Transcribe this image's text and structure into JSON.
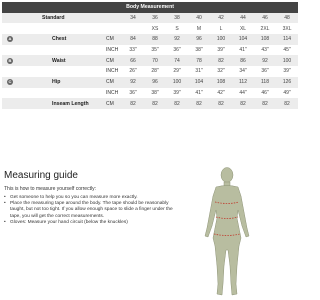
{
  "table": {
    "title": "Body Measurement",
    "standard_label": "Standard",
    "sizes": [
      "XS",
      "S",
      "M",
      "L",
      "XL",
      "2XL",
      "3XL"
    ],
    "standard_values": [
      "34",
      "36",
      "38",
      "40",
      "42",
      "44",
      "46",
      "48"
    ],
    "measurements": [
      {
        "marker": "A",
        "label": "Chest",
        "rows": [
          {
            "unit": "CM",
            "values": [
              "84",
              "88",
              "92",
              "96",
              "100",
              "104",
              "108",
              "114"
            ]
          },
          {
            "unit": "INCH",
            "values": [
              "33\"",
              "35\"",
              "36\"",
              "38\"",
              "39\"",
              "41\"",
              "43\"",
              "45\""
            ]
          }
        ]
      },
      {
        "marker": "B",
        "label": "Waist",
        "rows": [
          {
            "unit": "CM",
            "values": [
              "66",
              "70",
              "74",
              "78",
              "82",
              "86",
              "92",
              "100"
            ]
          },
          {
            "unit": "INCH",
            "values": [
              "26\"",
              "28\"",
              "29\"",
              "31\"",
              "32\"",
              "34\"",
              "36\"",
              "39\""
            ]
          }
        ]
      },
      {
        "marker": "C",
        "label": "Hip",
        "rows": [
          {
            "unit": "CM",
            "values": [
              "92",
              "96",
              "100",
              "104",
              "108",
              "112",
              "118",
              "126"
            ]
          },
          {
            "unit": "INCH",
            "values": [
              "36\"",
              "38\"",
              "39\"",
              "41\"",
              "42\"",
              "44\"",
              "46\"",
              "49\""
            ]
          }
        ]
      },
      {
        "marker": "",
        "label": "Inseam Length",
        "rows": [
          {
            "unit": "CM",
            "values": [
              "82",
              "82",
              "82",
              "82",
              "82",
              "82",
              "82",
              "82"
            ]
          }
        ]
      }
    ]
  },
  "guide": {
    "title": "Measuring guide",
    "intro": "This is how to measure yourself correctly:",
    "bullets": [
      "Get someone to help you so you can measure more exactly.",
      "Place the measuring tape around the body. The tape should be reasonably taught, but not too tight. If you allow enough space to slide a finger under the tape, you will get the correct measurements.",
      "Gloves: Measure your hand circuit (below the knuckles)"
    ]
  },
  "colors": {
    "header_bg": "#444444",
    "row_shade": "#ececec",
    "figure_fill": "#b8bda0",
    "marker_fill": "#666666",
    "tape_color": "#c0392b"
  },
  "icons": {
    "figure": "body-silhouette-icon"
  }
}
